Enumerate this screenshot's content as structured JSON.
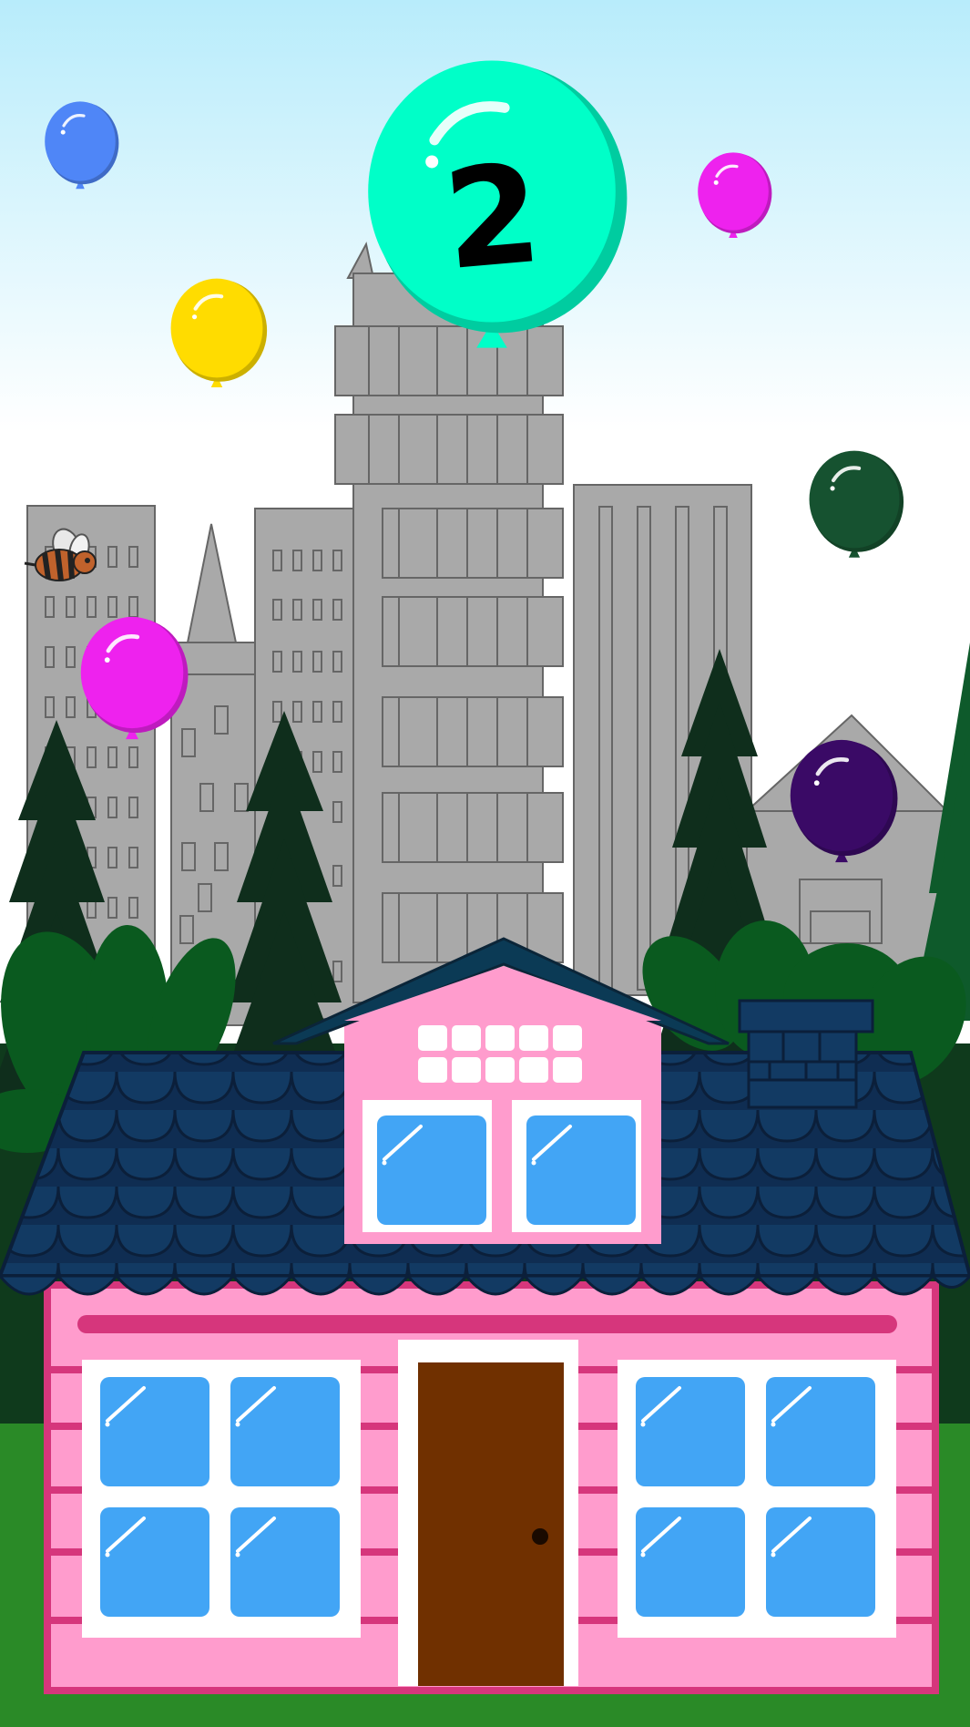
{
  "game": {
    "counter_value": "2"
  },
  "colors": {
    "sky_top": "#b8ecfb",
    "sky_bottom": "#ffffff",
    "grass": "#2a8a27",
    "forest_dark": "#0f3a1c",
    "building_gray": "#a9a9a9",
    "house_pink": "#ff9ccd",
    "house_trim": "#d6367c",
    "roof_navy": "#0f2d52",
    "window_blue": "#42a5f5",
    "door_brown": "#703000"
  },
  "balloons": [
    {
      "name": "counter-balloon-teal",
      "color": "#00ffc8"
    },
    {
      "name": "blue-balloon",
      "color": "#4f86f7"
    },
    {
      "name": "yellow-balloon",
      "color": "#ffdc00"
    },
    {
      "name": "magenta-balloon-top",
      "color": "#ee22ee"
    },
    {
      "name": "dark-green-balloon",
      "color": "#165230"
    },
    {
      "name": "magenta-balloon-left",
      "color": "#ee22ee"
    },
    {
      "name": "purple-balloon",
      "color": "#3a0a66"
    }
  ],
  "characters": [
    {
      "name": "bee-icon"
    }
  ]
}
